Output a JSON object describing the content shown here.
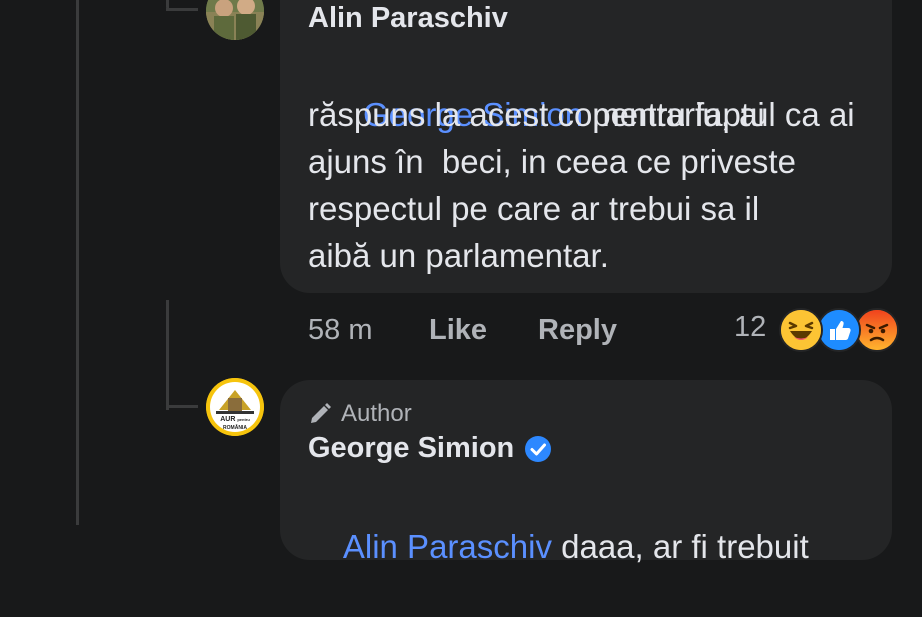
{
  "comments": [
    {
      "author": "Alin Paraschiv",
      "mention": "George Simion",
      "text_lines": [
        " pentru faptul ca ai",
        "răspuns la acest comentariu, ai",
        "ajuns în  beci, in ceea ce priveste",
        "respectul pe care ar trebui sa il",
        "aibă un parlamentar."
      ],
      "time": "58 m",
      "like_label": "Like",
      "reply_label": "Reply",
      "reaction_count": "12",
      "reactions": [
        "haha-icon",
        "like-icon",
        "angry-icon"
      ]
    },
    {
      "badge": "Author",
      "author": "George Simion",
      "verified": true,
      "mention": "Alin Paraschiv",
      "text_lines": [
        " daaa, ar fi trebuit"
      ],
      "avatar_text": [
        "AUR",
        "pentru",
        "ROMÂNIA"
      ]
    }
  ],
  "colors": {
    "background": "#18191a",
    "bubble": "#242526",
    "mention": "#5b90ff",
    "muted": "#b0b3b8",
    "verified": "#2d88ff"
  }
}
